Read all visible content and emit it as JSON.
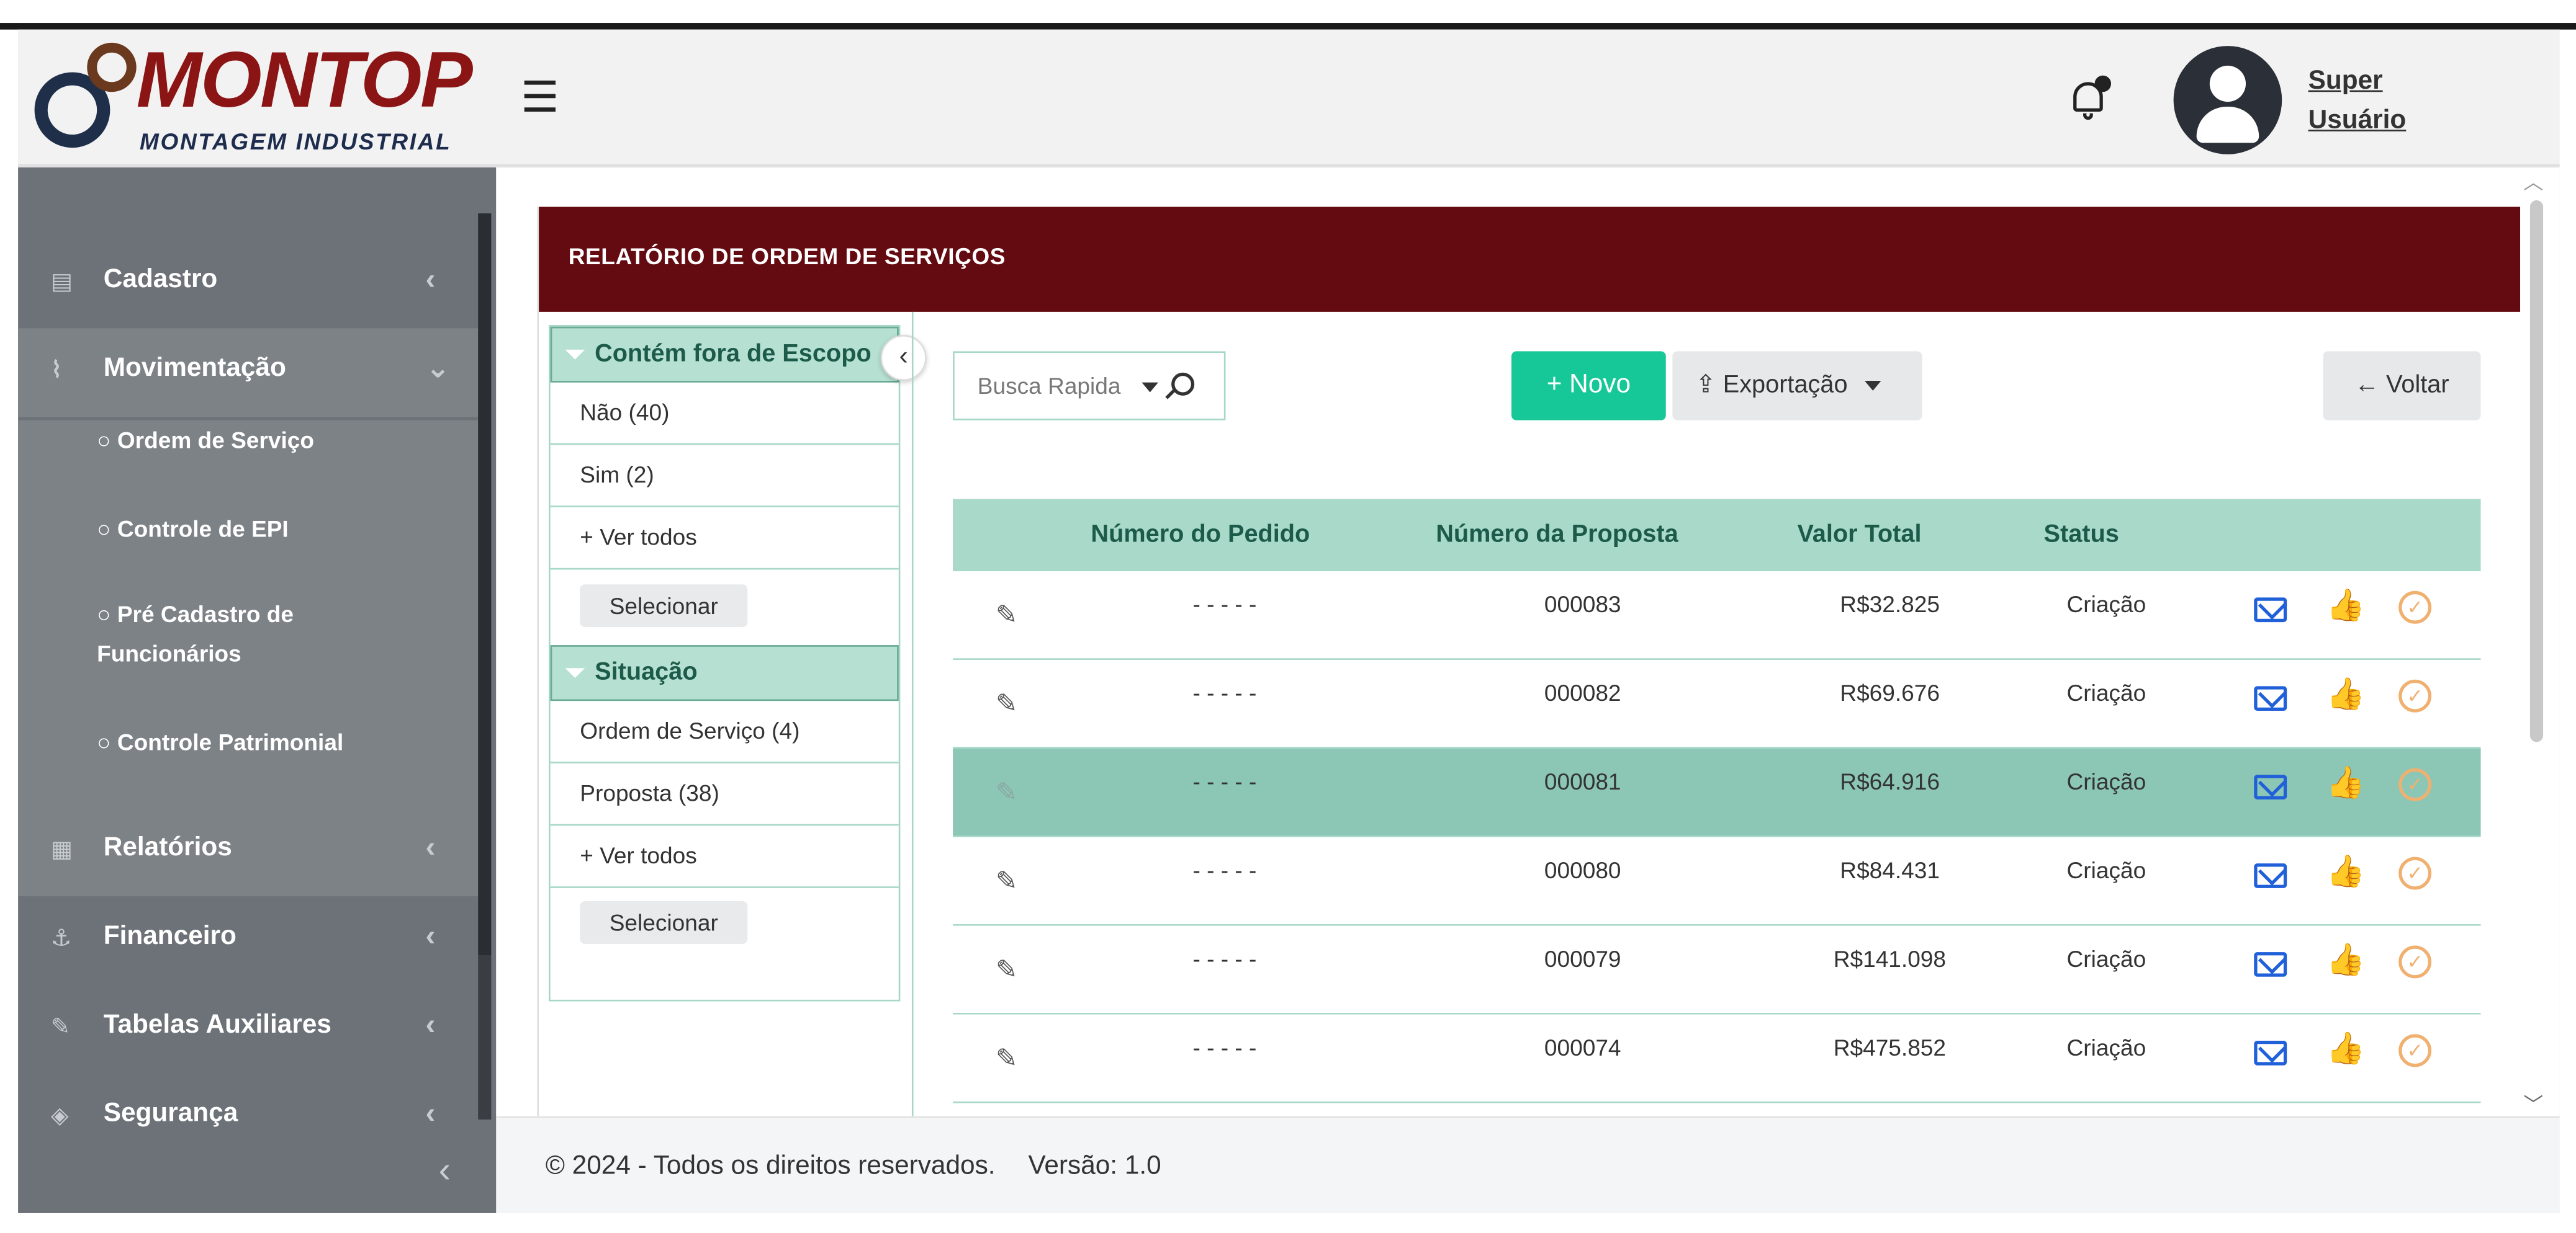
{
  "brand": {
    "name": "MONTOP",
    "tagline": "MONTAGEM INDUSTRIAL"
  },
  "header": {
    "menu_icon": "hamburger-icon",
    "bell_icon": "bell-icon",
    "user_line1": "Super",
    "user_line2": "Usuário"
  },
  "sidebar": {
    "items": [
      {
        "label": "Cadastro",
        "icon": "book-icon"
      },
      {
        "label": "Movimentação",
        "icon": "chart-line-icon"
      },
      {
        "label": "Relatórios",
        "icon": "table-icon"
      },
      {
        "label": "Financeiro",
        "icon": "hand-money-icon"
      },
      {
        "label": "Tabelas Auxiliares",
        "icon": "wrench-icon"
      },
      {
        "label": "Segurança",
        "icon": "shield-icon"
      }
    ],
    "subitems": [
      "○ Ordem de Serviço",
      "○ Controle de EPI",
      "○ Pré Cadastro de Funcionários",
      "○ Controle Patrimonial"
    ]
  },
  "page": {
    "title": "RELATÓRIO DE ORDEM DE SERVIÇOS"
  },
  "filters": {
    "group1": {
      "title": "Contém fora de Escopo",
      "options": [
        "Não (40)",
        "Sim (2)",
        "+ Ver todos"
      ],
      "button": "Selecionar"
    },
    "group2": {
      "title": "Situação",
      "options": [
        "Ordem de Serviço (4)",
        "Proposta (38)",
        "+ Ver todos"
      ],
      "button": "Selecionar"
    }
  },
  "toolbar": {
    "search_placeholder": "Busca Rapida",
    "novo": "+ Novo",
    "export": "Exportação",
    "voltar": "← Voltar"
  },
  "table": {
    "headers": [
      "Número do Pedido",
      "Número da Proposta",
      "Valor Total",
      "Status"
    ],
    "rows": [
      {
        "pedido": "- - - - -",
        "proposta": "000083",
        "valor": "R$32.825",
        "status": "Criação"
      },
      {
        "pedido": "- - - - -",
        "proposta": "000082",
        "valor": "R$69.676",
        "status": "Criação"
      },
      {
        "pedido": "- - - - -",
        "proposta": "000081",
        "valor": "R$64.916",
        "status": "Criação"
      },
      {
        "pedido": "- - - - -",
        "proposta": "000080",
        "valor": "R$84.431",
        "status": "Criação"
      },
      {
        "pedido": "- - - - -",
        "proposta": "000079",
        "valor": "R$141.098",
        "status": "Criação"
      },
      {
        "pedido": "- - - - -",
        "proposta": "000074",
        "valor": "R$475.852",
        "status": "Criação"
      }
    ],
    "selected_row": 2
  },
  "footer": {
    "copyright": "© 2024 - Todos os direitos reservados.",
    "version": "Versão: 1.0"
  },
  "colors": {
    "header_bar": "#640b12",
    "accent_green": "#16c898",
    "table_head": "#a9d9c9",
    "sidebar": "#6c7278"
  }
}
